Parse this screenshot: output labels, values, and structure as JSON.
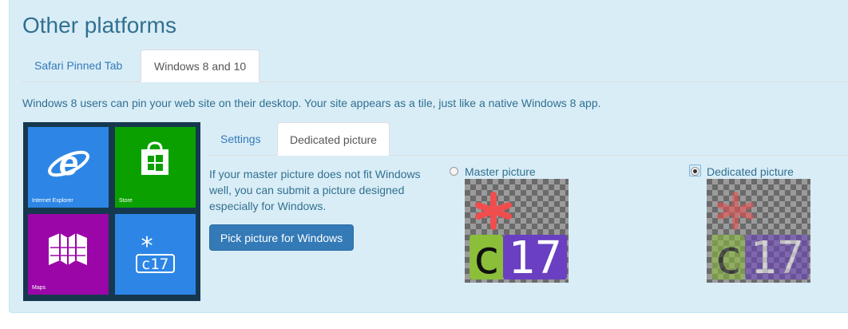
{
  "section": {
    "title": "Other platforms"
  },
  "top_tabs": [
    {
      "label": "Safari Pinned Tab",
      "active": false
    },
    {
      "label": "Windows 8 and 10",
      "active": true
    }
  ],
  "description": "Windows 8 users can pin your web site on their desktop. Your site appears as a tile, just like a native Windows 8 app.",
  "tiles": [
    {
      "label": "Internet Explorer",
      "color": "#2d86e5",
      "icon": "internet-explorer-icon"
    },
    {
      "label": "Store",
      "color": "#0aa100",
      "icon": "store-icon"
    },
    {
      "label": "Maps",
      "color": "#9a06a7",
      "icon": "maps-icon"
    },
    {
      "label": "",
      "color": "#2d86e5",
      "icon": "c17-logo-icon"
    }
  ],
  "sub_tabs": [
    {
      "label": "Settings",
      "active": false
    },
    {
      "label": "Dedicated picture",
      "active": true
    }
  ],
  "help_text": "If your master picture does not fit Windows well, you can submit a picture designed especially for Windows.",
  "pick_button": "Pick picture for Windows",
  "options": [
    {
      "label": "Master picture",
      "checked": false
    },
    {
      "label": "Dedicated picture",
      "checked": true
    }
  ],
  "logo_text": {
    "letter": "c",
    "number": "17",
    "star": "*"
  },
  "colors": {
    "accent": "#337ab7",
    "panel_bg": "#d9edf7",
    "text": "#31708f",
    "logo_green": "#8bbf3a",
    "logo_purple": "#6a3fc1",
    "logo_star": "#f04e4e"
  }
}
